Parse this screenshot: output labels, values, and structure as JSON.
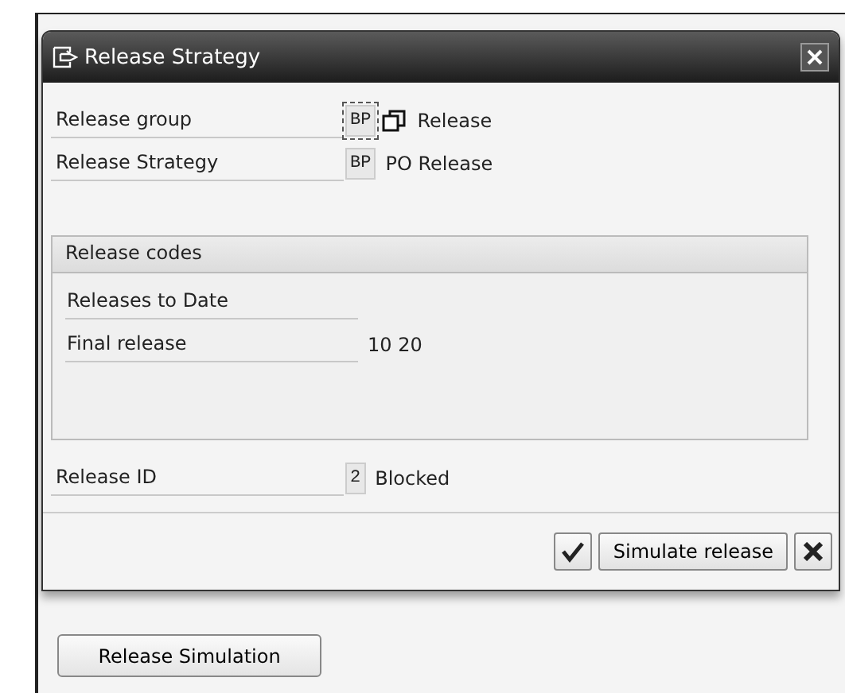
{
  "dialog": {
    "title": "Release Strategy",
    "fields": [
      {
        "label": "Release group",
        "code": "BP",
        "description": "Release",
        "kind": "focused"
      },
      {
        "label": "Release Strategy",
        "code": "BP",
        "description": "PO Release",
        "kind": "plain"
      }
    ],
    "group": {
      "title": "Release codes",
      "rows": [
        {
          "label": "Releases to Date",
          "value": ""
        },
        {
          "label": "Final release",
          "value": "10 20"
        }
      ]
    },
    "release_id": {
      "label": "Release ID",
      "code": "2",
      "description": "Blocked"
    },
    "buttons": [
      {
        "kind": "check"
      },
      {
        "kind": "text",
        "label": "Simulate release"
      },
      {
        "kind": "cancel"
      }
    ]
  },
  "main_button": "Release Simulation"
}
